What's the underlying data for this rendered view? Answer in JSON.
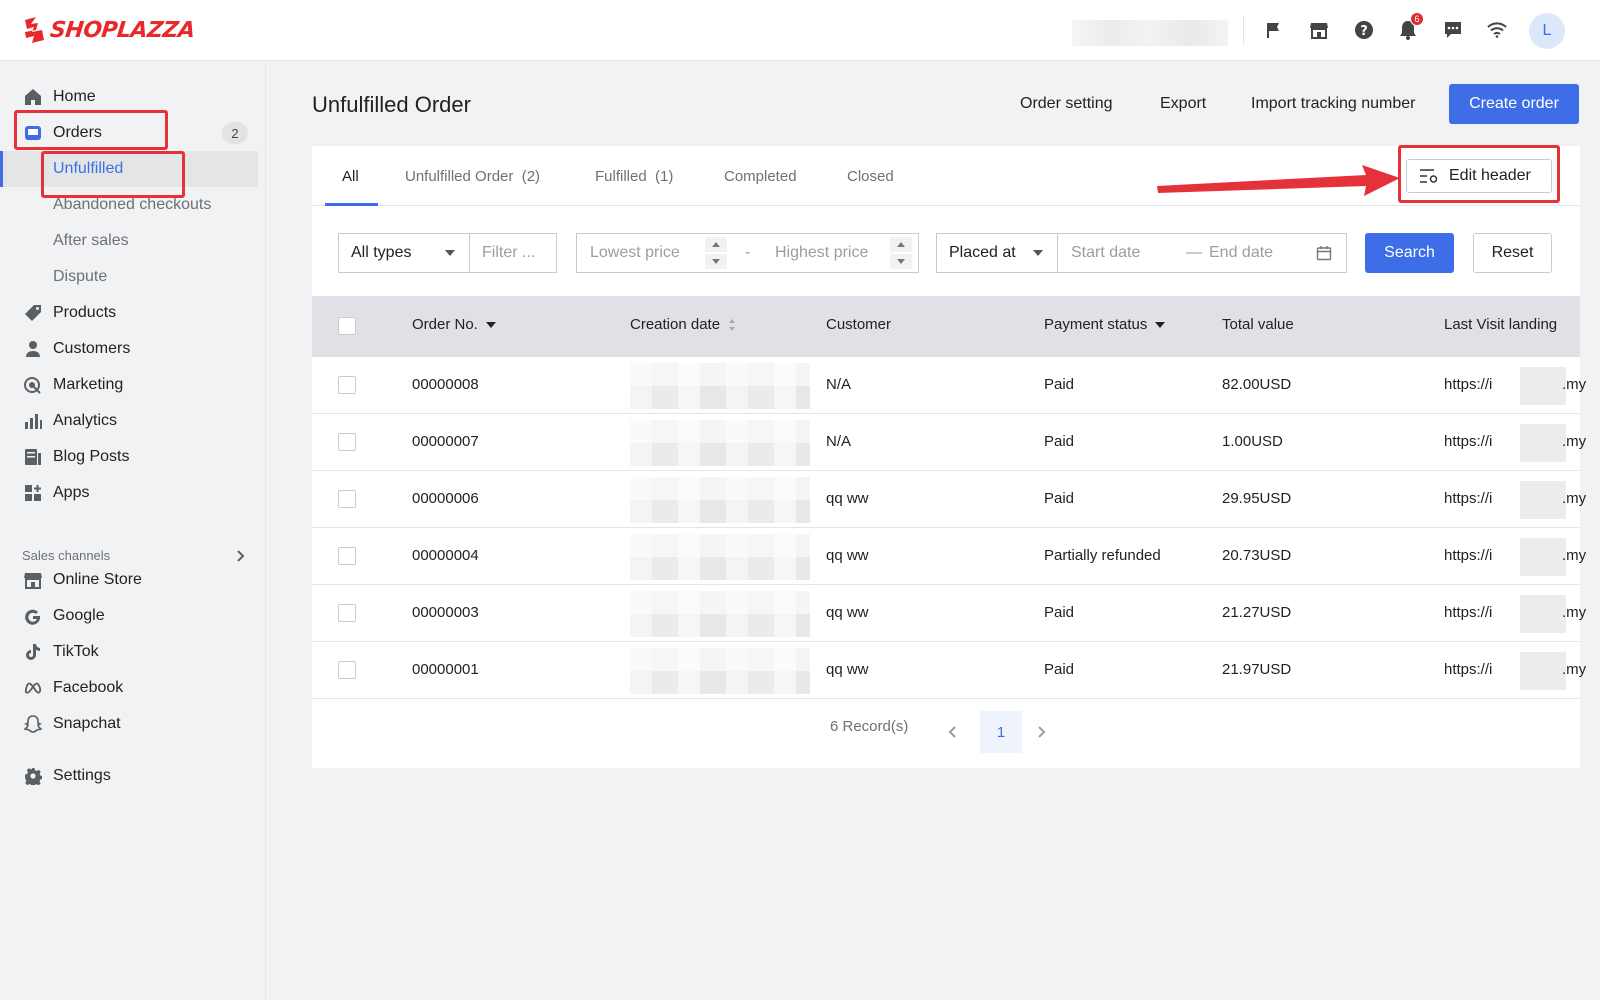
{
  "brand": {
    "name": "SHOPLAZZA",
    "color": "#e8282b"
  },
  "topbar": {
    "icons": [
      "flag-icon",
      "store-icon",
      "help-icon",
      "bell-icon",
      "message-icon",
      "wifi-icon"
    ],
    "notification_count": "6",
    "avatar_letter": "L"
  },
  "sidebar": {
    "items": [
      {
        "label": "Home",
        "icon": "home-icon"
      },
      {
        "label": "Orders",
        "icon": "orders-icon",
        "count": "2"
      },
      {
        "label": "Unfulfilled"
      },
      {
        "label": "Abandoned checkouts"
      },
      {
        "label": "After sales"
      },
      {
        "label": "Dispute"
      },
      {
        "label": "Products",
        "icon": "tag-icon"
      },
      {
        "label": "Customers",
        "icon": "person-icon"
      },
      {
        "label": "Marketing",
        "icon": "marketing-icon"
      },
      {
        "label": "Analytics",
        "icon": "analytics-icon"
      },
      {
        "label": "Blog Posts",
        "icon": "blog-icon"
      },
      {
        "label": "Apps",
        "icon": "apps-icon"
      }
    ],
    "sales_channels_title": "Sales channels",
    "channels": [
      {
        "label": "Online Store",
        "icon": "store-icon"
      },
      {
        "label": "Google",
        "icon": "google-icon"
      },
      {
        "label": "TikTok",
        "icon": "tiktok-icon"
      },
      {
        "label": "Facebook",
        "icon": "meta-icon"
      },
      {
        "label": "Snapchat",
        "icon": "snapchat-icon"
      }
    ],
    "settings_label": "Settings"
  },
  "header": {
    "title": "Unfulfilled Order",
    "actions": [
      "Order setting",
      "Export",
      "Import tracking number"
    ],
    "create_label": "Create order"
  },
  "tabs": [
    {
      "label": "All"
    },
    {
      "label": "Unfulfilled Order  (2)"
    },
    {
      "label": "Fulfilled  (1)"
    },
    {
      "label": "Completed"
    },
    {
      "label": "Closed"
    }
  ],
  "edit_header_label": "Edit header",
  "filters": {
    "type_value": "All types",
    "filter_placeholder": "Filter ...",
    "lowest_placeholder": "Lowest price",
    "range_sep": "-",
    "highest_placeholder": "Highest price",
    "date_type_value": "Placed at",
    "start_placeholder": "Start date",
    "date_sep": "—",
    "end_placeholder": "End date",
    "search_label": "Search",
    "reset_label": "Reset"
  },
  "table": {
    "columns": [
      "Order No.",
      "Creation date",
      "Customer",
      "Payment status",
      "Total value",
      "Last Visit landing"
    ],
    "rows": [
      {
        "order": "00000008",
        "customer": "N/A",
        "status": "Paid",
        "total": "82.00USD",
        "url_start": "https://i",
        "url_end": ".my"
      },
      {
        "order": "00000007",
        "customer": "N/A",
        "status": "Paid",
        "total": "1.00USD",
        "url_start": "https://i",
        "url_end": ".my"
      },
      {
        "order": "00000006",
        "customer": "qq ww",
        "status": "Paid",
        "total": "29.95USD",
        "url_start": "https://i",
        "url_end": ".my"
      },
      {
        "order": "00000004",
        "customer": "qq ww",
        "status": "Partially refunded",
        "total": "20.73USD",
        "url_start": "https://i",
        "url_end": ".my"
      },
      {
        "order": "00000003",
        "customer": "qq ww",
        "status": "Paid",
        "total": "21.27USD",
        "url_start": "https://i",
        "url_end": ".my"
      },
      {
        "order": "00000001",
        "customer": "qq ww",
        "status": "Paid",
        "total": "21.97USD",
        "url_start": "https://i",
        "url_end": ".my"
      }
    ]
  },
  "pagination": {
    "records": "6 Record(s)",
    "current_page": "1"
  },
  "accent_color": "#3d6ee8",
  "highlight_color": "#e5323a"
}
